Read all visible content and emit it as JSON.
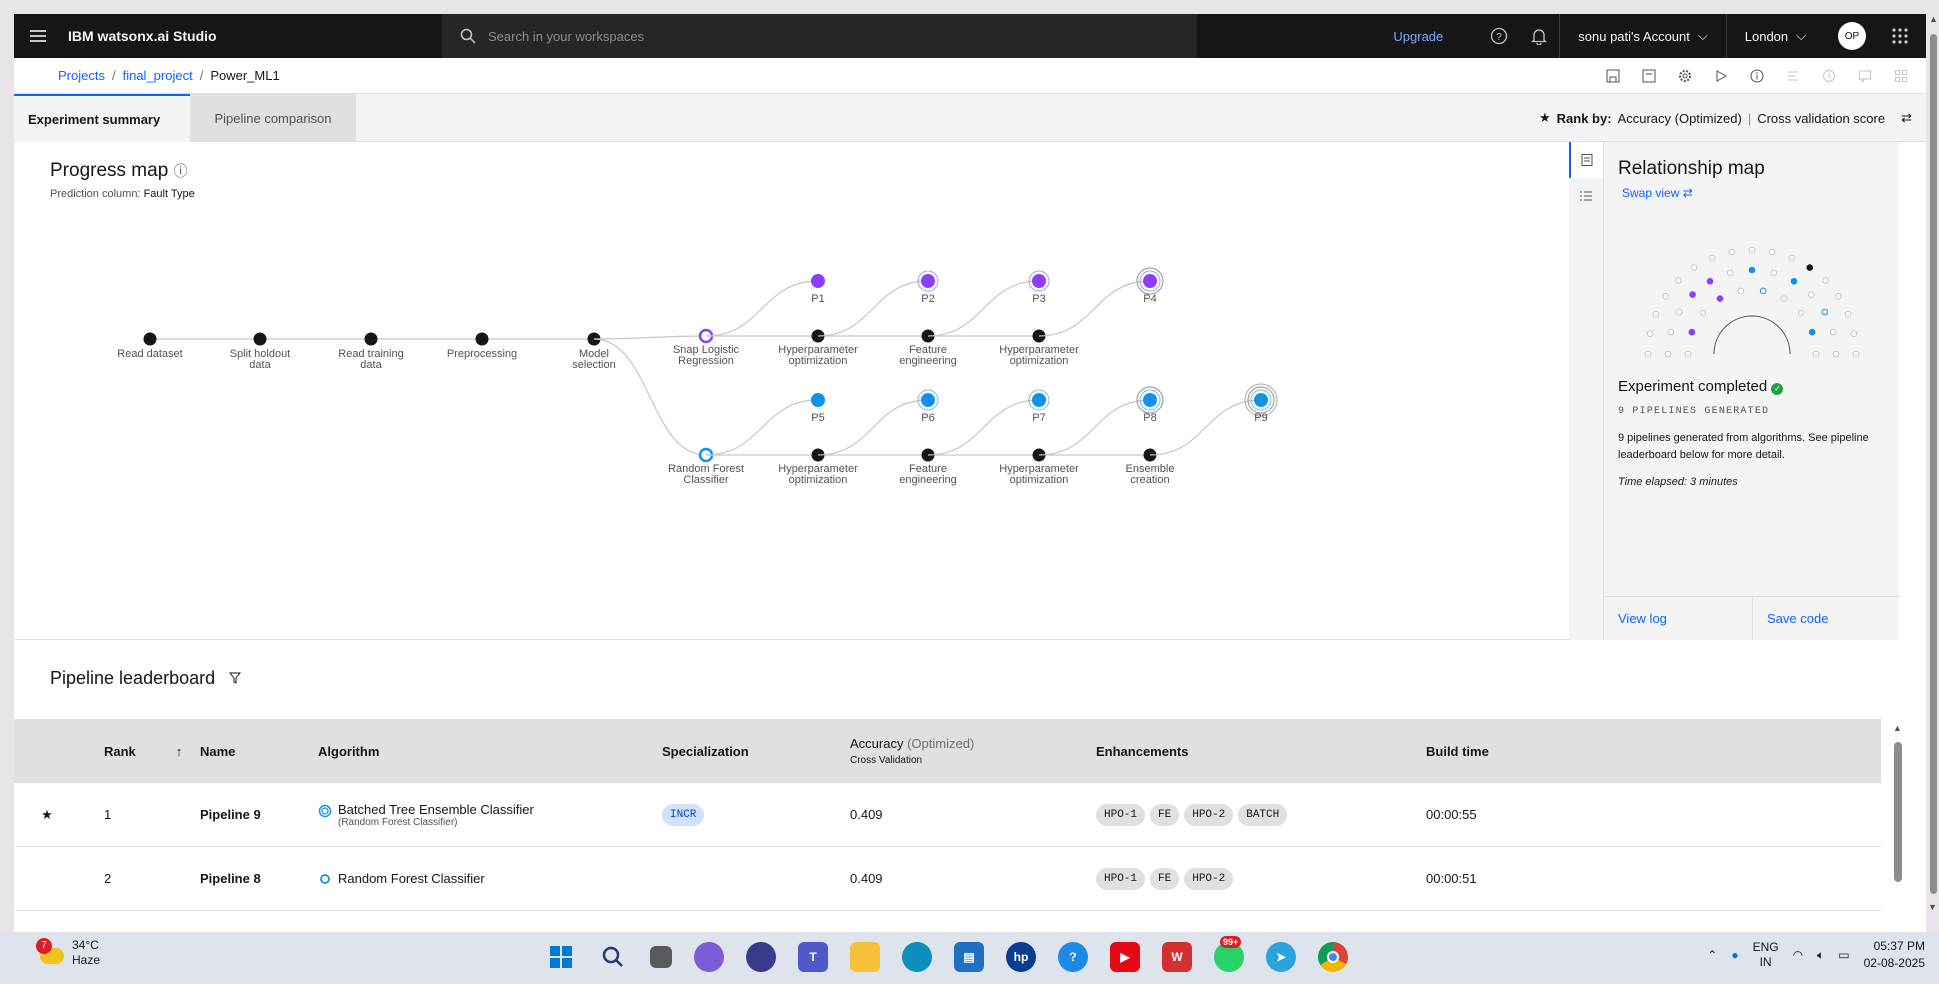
{
  "topbar": {
    "brand": "IBM watsonx.ai Studio",
    "search_placeholder": "Search in your workspaces",
    "upgrade": "Upgrade",
    "account": "sonu pati's Account",
    "region": "London",
    "avatar": "OP"
  },
  "breadcrumb": {
    "projects": "Projects",
    "project": "final_project",
    "current": "Power_ML1"
  },
  "tabs": {
    "summary": "Experiment summary",
    "comparison": "Pipeline comparison"
  },
  "rankby": {
    "label": "Rank by:",
    "metric": "Accuracy (Optimized)",
    "score": "Cross validation score"
  },
  "progress": {
    "title": "Progress map",
    "prediction_label": "Prediction column:",
    "prediction_value": "Fault Type",
    "nodes": [
      "Read dataset",
      "Split holdout data",
      "Read training data",
      "Preprocessing",
      "Model selection"
    ],
    "branch1": {
      "algorithm": "Snap Logistic Regression",
      "steps": [
        "Hyperparameter optimization",
        "Feature engineering",
        "Hyperparameter optimization"
      ],
      "pipelines": [
        "P1",
        "P2",
        "P3",
        "P4"
      ]
    },
    "branch2": {
      "algorithm": "Random Forest Classifier",
      "steps": [
        "Hyperparameter optimization",
        "Feature engineering",
        "Hyperparameter optimization",
        "Ensemble creation"
      ],
      "pipelines": [
        "P5",
        "P6",
        "P7",
        "P8",
        "P9"
      ]
    }
  },
  "relmap": {
    "title": "Relationship map",
    "swap": "Swap view",
    "status": "Experiment completed",
    "generated": "9 PIPELINES GENERATED",
    "desc": "9 pipelines generated from algorithms. See pipeline leaderboard below for more detail.",
    "time": "Time elapsed: 3 minutes",
    "view_log": "View log",
    "save_code": "Save code"
  },
  "leaderboard": {
    "title": "Pipeline leaderboard",
    "headers": {
      "rank": "Rank",
      "name": "Name",
      "algorithm": "Algorithm",
      "specialization": "Specialization",
      "accuracy": "Accuracy",
      "optimized": "(Optimized)",
      "cv": "Cross Validation",
      "enhancements": "Enhancements",
      "build": "Build time"
    },
    "rows": [
      {
        "rank": "1",
        "name": "Pipeline 9",
        "algorithm": "Batched Tree Ensemble Classifier",
        "algo_sub": "(Random Forest Classifier)",
        "spec": "INCR",
        "accuracy": "0.409",
        "enh": [
          "HPO-1",
          "FE",
          "HPO-2",
          "BATCH"
        ],
        "build": "00:00:55"
      },
      {
        "rank": "2",
        "name": "Pipeline 8",
        "algorithm": "Random Forest Classifier",
        "algo_sub": "",
        "spec": "",
        "accuracy": "0.409",
        "enh": [
          "HPO-1",
          "FE",
          "HPO-2"
        ],
        "build": "00:00:51"
      }
    ]
  },
  "taskbar": {
    "temp": "34°C",
    "weather": "Haze",
    "weather_badge": "7",
    "lang1": "ENG",
    "lang2": "IN",
    "time": "05:37 PM",
    "date": "02-08-2025",
    "wa_badge": "99+"
  },
  "colors": {
    "accent": "#0f62fe",
    "purple": "#8a3ffc",
    "cyan": "#1192e8"
  }
}
